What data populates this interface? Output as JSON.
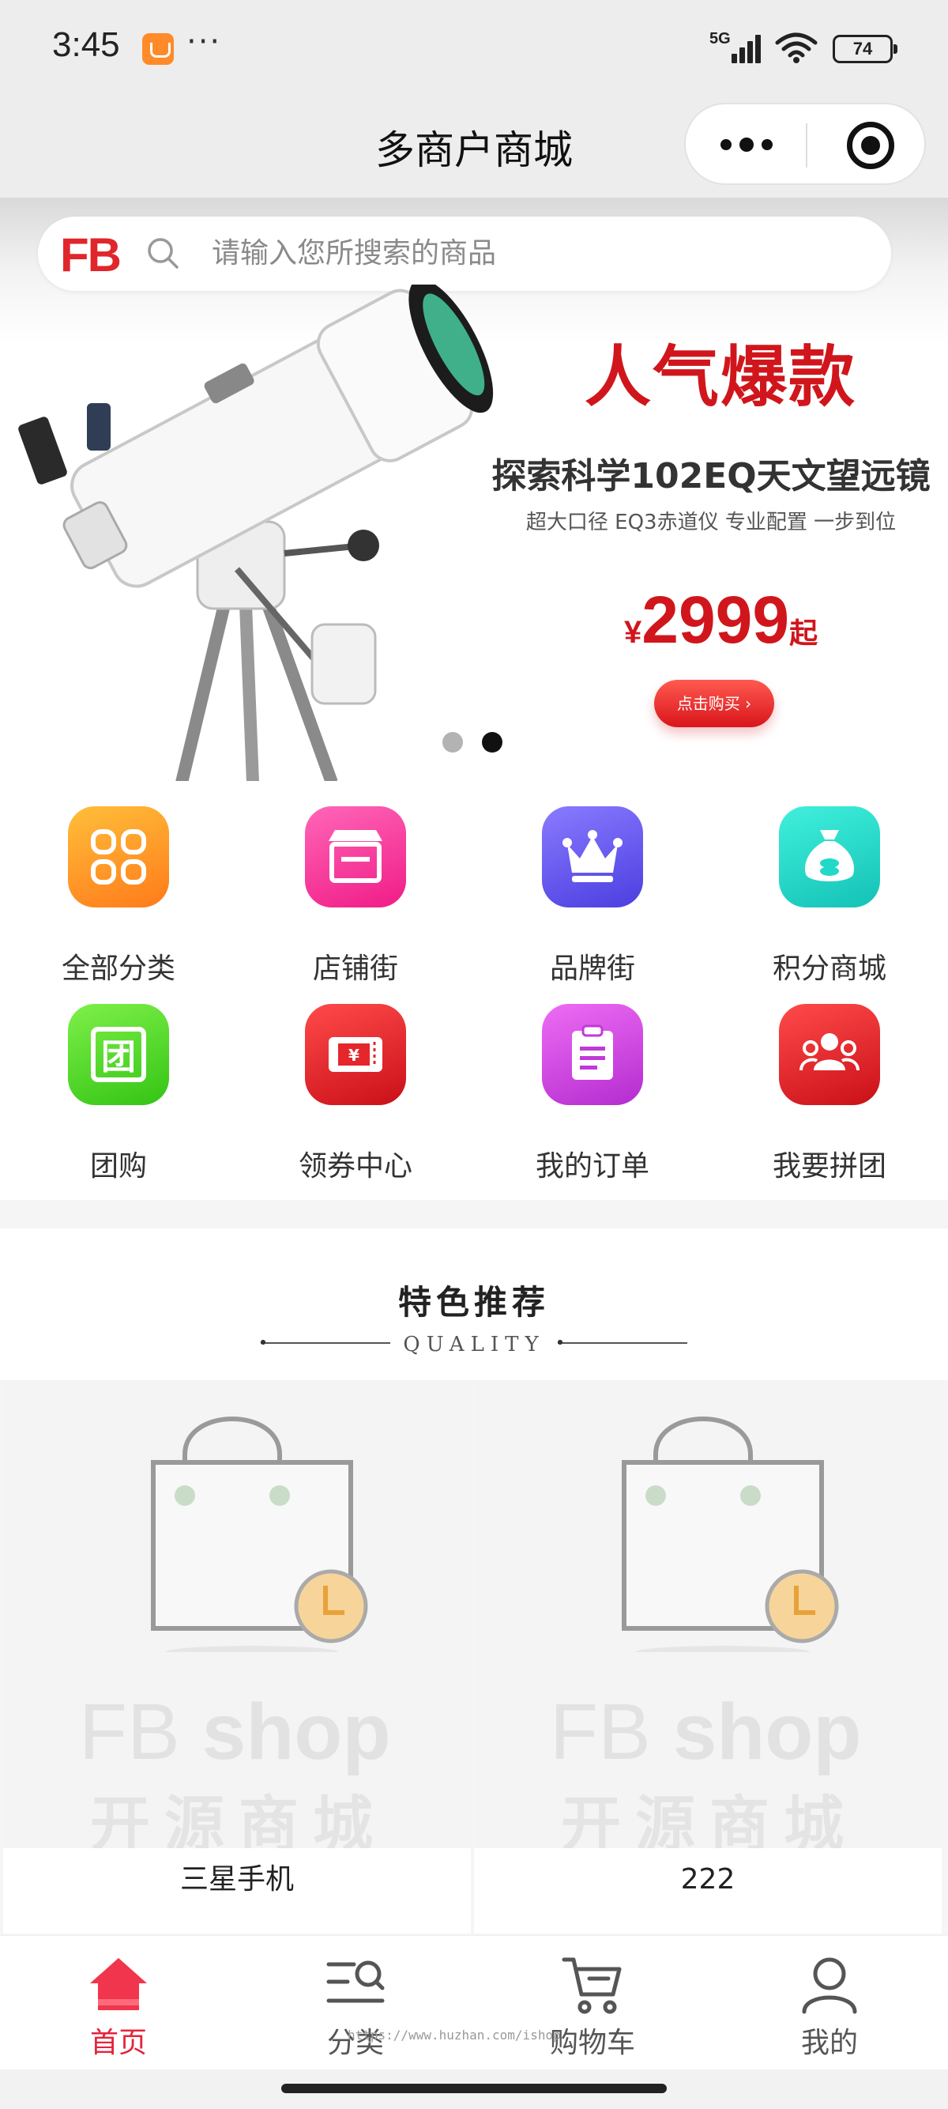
{
  "status_bar": {
    "time": "3:45",
    "more": "···",
    "network": "5G",
    "battery": "74"
  },
  "nav": {
    "title": "多商户商城"
  },
  "search": {
    "logo_text": "FB",
    "placeholder": "请输入您所搜索的商品"
  },
  "banner": {
    "title": "人气爆款",
    "subtitle": "探索科学102EQ天文望远镜",
    "desc": "超大口径 EQ3赤道仪 专业配置 一步到位",
    "price_currency": "¥",
    "price_value": "2999",
    "price_suffix": "起",
    "cta": "点击购买 ›",
    "page_count": 2,
    "active_page": 2
  },
  "categories": [
    {
      "label": "全部分类",
      "icon": "grid-icon",
      "color": "#ff9a1f"
    },
    {
      "label": "店铺街",
      "icon": "store-icon",
      "color": "#ff3fa0"
    },
    {
      "label": "品牌街",
      "icon": "crown-icon",
      "color": "#6a5cf0"
    },
    {
      "label": "积分商城",
      "icon": "money-bag-icon",
      "color": "#22d8c8"
    },
    {
      "label": "团购",
      "icon": "group-buy-icon",
      "color": "#52d92e"
    },
    {
      "label": "领券中心",
      "icon": "coupon-icon",
      "color": "#e5262b"
    },
    {
      "label": "我的订单",
      "icon": "order-icon",
      "color": "#d04de0"
    },
    {
      "label": "我要拼团",
      "icon": "team-icon",
      "color": "#e5262b"
    }
  ],
  "recommend": {
    "title": "特色推荐",
    "subtitle": "QUALITY"
  },
  "products": [
    {
      "name": "三星手机",
      "watermark_latin": "FB",
      "watermark_latin_bold": "shop",
      "watermark_cn": "开源商城"
    },
    {
      "name": "222",
      "watermark_latin": "FB",
      "watermark_latin_bold": "shop",
      "watermark_cn": "开源商城"
    }
  ],
  "tabs": [
    {
      "label": "首页",
      "icon": "home-icon",
      "active": true
    },
    {
      "label": "分类",
      "icon": "category-search-icon",
      "active": false
    },
    {
      "label": "购物车",
      "icon": "cart-icon",
      "active": false
    },
    {
      "label": "我的",
      "icon": "user-icon",
      "active": false
    }
  ],
  "tab_watermark": "https://www.huzhan.com/ishop",
  "colors": {
    "accent": "#e5233b",
    "brand_red": "#d0161c"
  }
}
